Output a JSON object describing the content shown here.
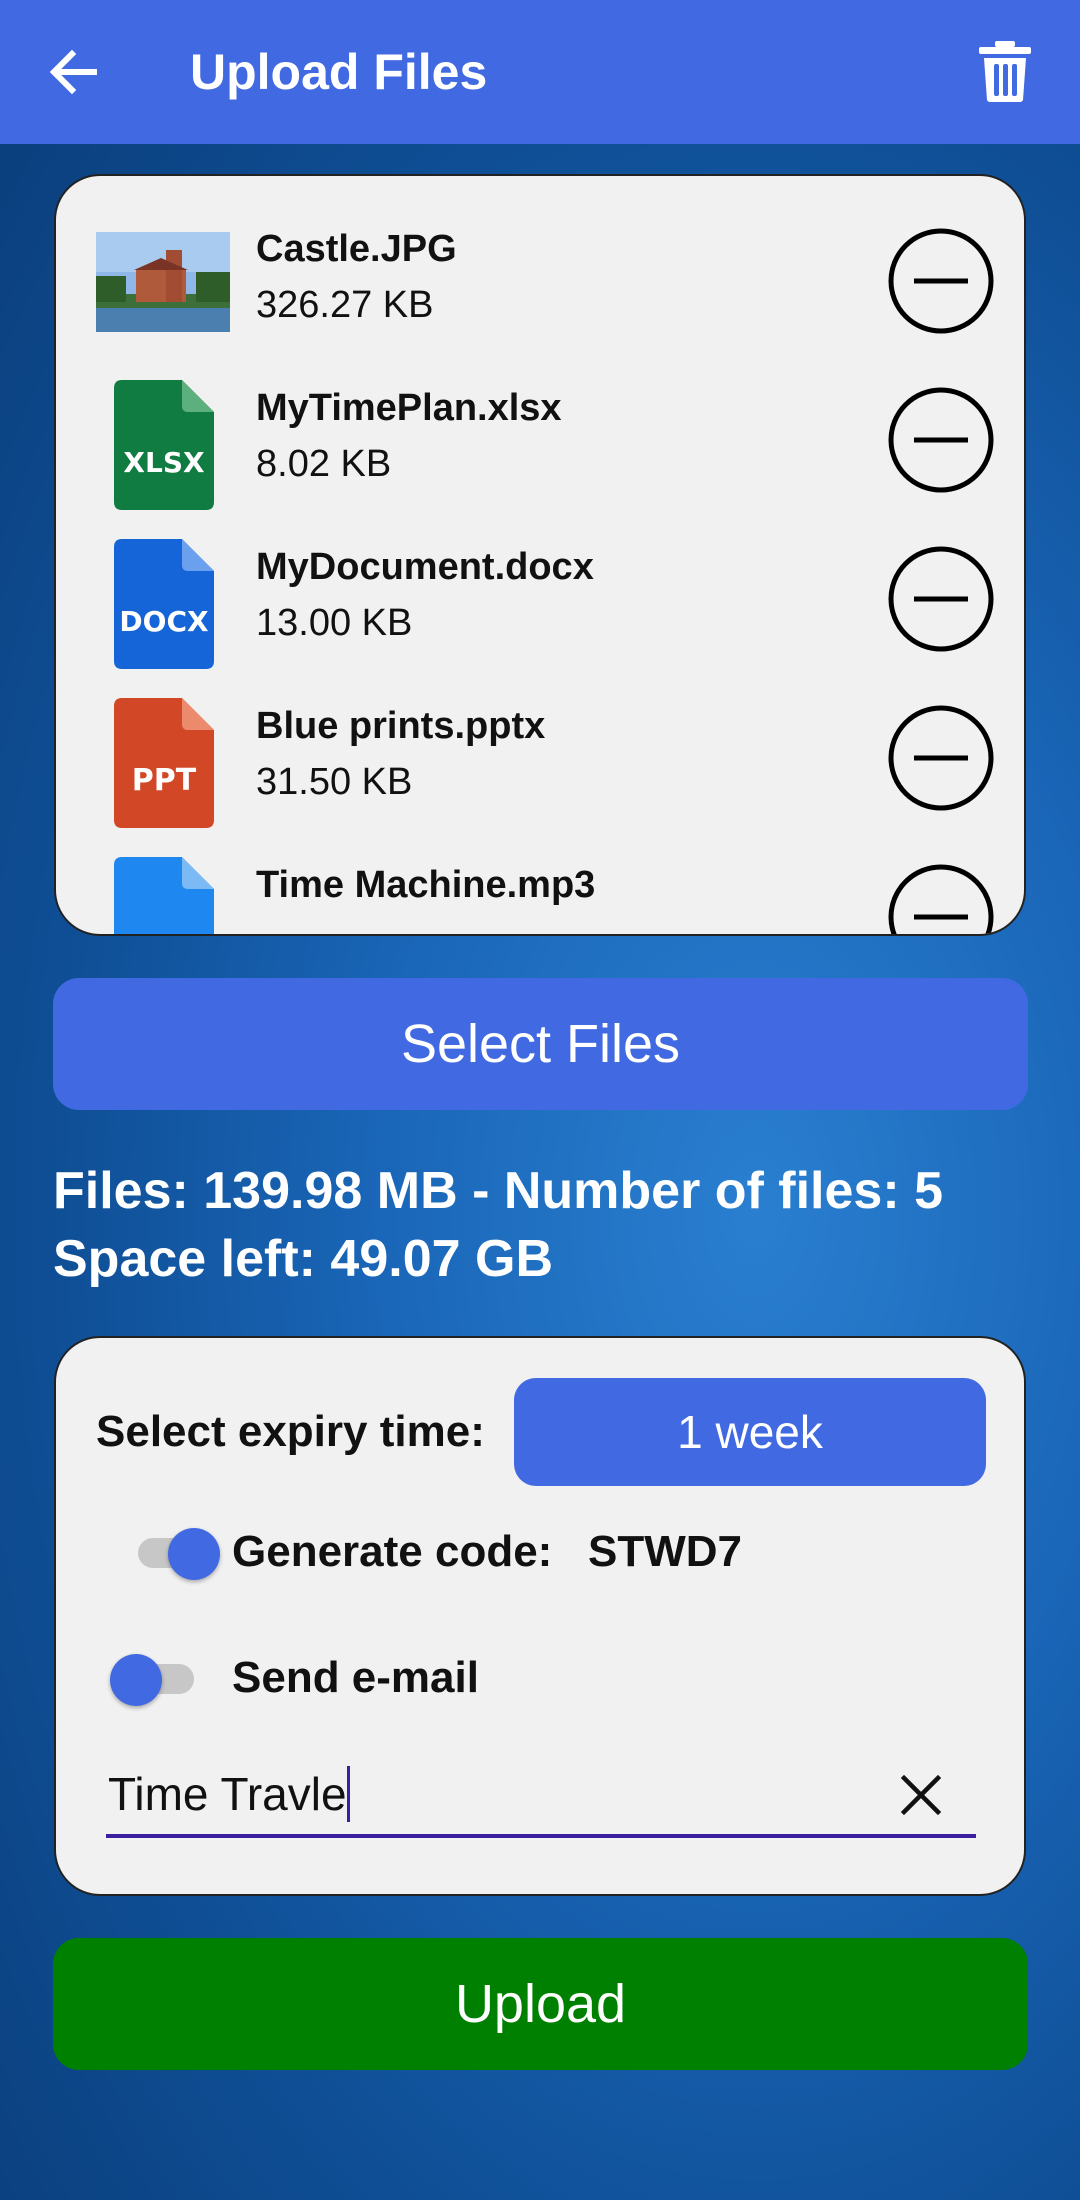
{
  "appbar": {
    "title": "Upload Files",
    "back_icon": "arrow-left-icon",
    "action_icon": "trash-icon"
  },
  "files": [
    {
      "name": "Castle.JPG",
      "size": "326.27 KB",
      "icon": "image-thumbnail"
    },
    {
      "name": "MyTimePlan.xlsx",
      "size": "8.02 KB",
      "icon": "xlsx-file-icon",
      "badge": "XLSX",
      "color": "#107c41"
    },
    {
      "name": "MyDocument.docx",
      "size": "13.00 KB",
      "icon": "docx-file-icon",
      "badge": "DOCX",
      "color": "#1565d8"
    },
    {
      "name": "Blue prints.pptx",
      "size": "31.50 KB",
      "icon": "ppt-file-icon",
      "badge": "PPT",
      "color": "#d24726"
    },
    {
      "name": "Time Machine.mp3",
      "size": "",
      "icon": "audio-file-icon",
      "color": "#1e88f0"
    }
  ],
  "select_files_label": "Select Files",
  "summary": {
    "line1": "Files: 139.98 MB - Number of files: 5",
    "line2": "Space left: 49.07 GB"
  },
  "settings": {
    "expiry_label": "Select expiry time:",
    "expiry_value": "1 week",
    "generate_code_label": "Generate code:",
    "generate_code_value": "STWD7",
    "generate_code_on": true,
    "send_email_label": "Send e-mail",
    "send_email_on": false,
    "input_value": "Time Travle"
  },
  "upload_label": "Upload",
  "colors": {
    "primary": "#4169e1",
    "upload": "#008000",
    "card": "#f1f1f1"
  }
}
